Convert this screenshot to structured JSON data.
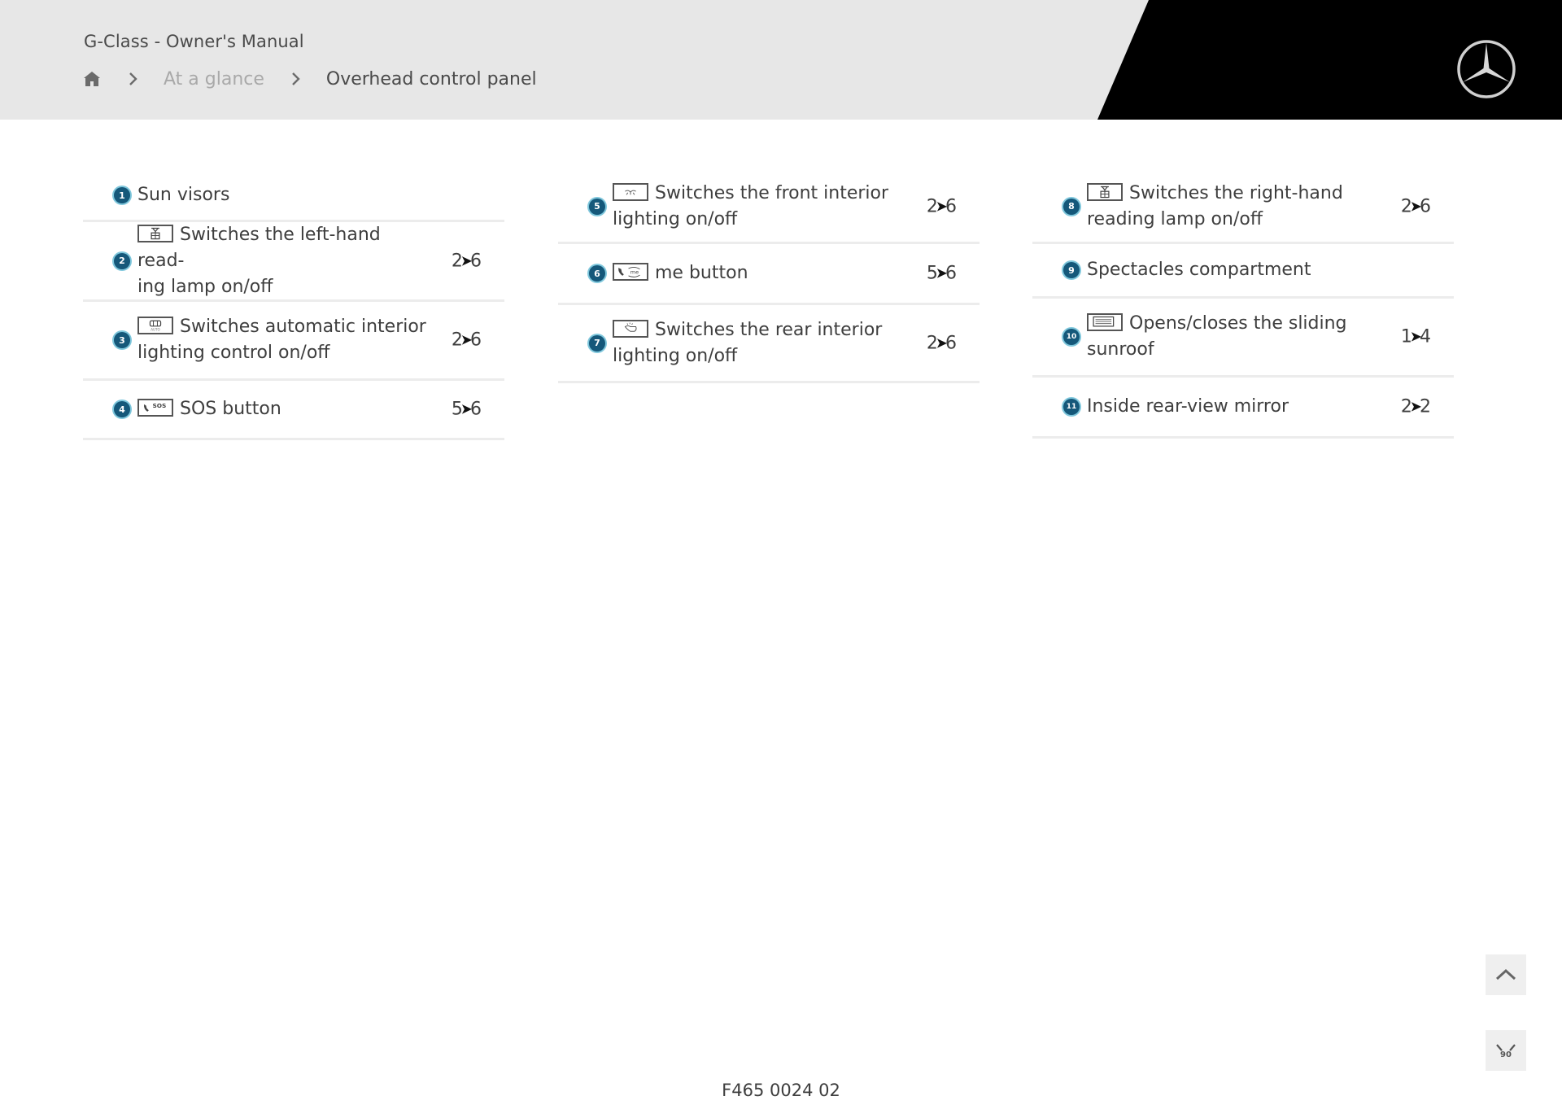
{
  "header": {
    "title": "G-Class - Owner's Manual",
    "breadcrumb": {
      "home_icon": "home-icon",
      "separator_icon": "chevron-right-icon",
      "items": [
        "At a glance",
        "Overhead control panel"
      ]
    },
    "logo": "mercedes-star-logo"
  },
  "items": [
    {
      "num": "1",
      "label": "Sun visors",
      "icon": null,
      "page": null
    },
    {
      "num": "2",
      "label": "Switches the left-hand read-ing lamp on/off",
      "line1": "Switches the left-hand read-",
      "line2": "ing lamp on/off",
      "icon": "left-reading-lamp-icon",
      "page": {
        "a": "2",
        "b": "6"
      }
    },
    {
      "num": "3",
      "label": "Switches automatic interior lighting control on/off",
      "line1": "Switches automatic interior",
      "line2": "lighting control on/off",
      "icon": "auto-interior-lighting-icon",
      "page": {
        "a": "2",
        "b": "6"
      }
    },
    {
      "num": "4",
      "label": "SOS button",
      "icon": "sos-icon",
      "page": {
        "a": "5",
        "b": "6"
      }
    },
    {
      "num": "5",
      "label": "Switches the front interior lighting on/off",
      "line1": "Switches the front interior",
      "line2": "lighting on/off",
      "icon": "front-interior-lighting-icon",
      "page": {
        "a": "2",
        "b": "6"
      }
    },
    {
      "num": "6",
      "label": "me button",
      "icon": "me-call-icon",
      "page": {
        "a": "5",
        "b": "6"
      }
    },
    {
      "num": "7",
      "label": "Switches the rear interior lighting on/off",
      "line1": "Switches the rear interior",
      "line2": "lighting on/off",
      "icon": "rear-interior-lighting-icon",
      "page": {
        "a": "2",
        "b": "6"
      }
    },
    {
      "num": "8",
      "label": "Switches the right-hand reading lamp on/off",
      "line1": "Switches the right-hand",
      "line2": "reading lamp on/off",
      "icon": "right-reading-lamp-icon",
      "page": {
        "a": "2",
        "b": "6"
      }
    },
    {
      "num": "9",
      "label": "Spectacles compartment",
      "icon": null,
      "page": null
    },
    {
      "num": "10",
      "label": "Opens/closes the sliding sunroof",
      "line1": "Opens/closes the sliding",
      "line2": "sunroof",
      "icon": "sliding-sunroof-icon",
      "page": {
        "a": "1",
        "b": "4"
      }
    },
    {
      "num": "11",
      "label": "Inside rear-view mirror",
      "icon": null,
      "page": {
        "a": "2",
        "b": "2"
      }
    }
  ],
  "page_arrow": "➤",
  "footer": {
    "code": "F465 0024 02"
  },
  "side_buttons": {
    "up": "scroll-to-top",
    "down": "collapse"
  },
  "colors": {
    "badge": "#15587a",
    "badge_halo": "#7fc7dc",
    "header_bg": "#e7e7e7",
    "header_dark": "#000000"
  }
}
